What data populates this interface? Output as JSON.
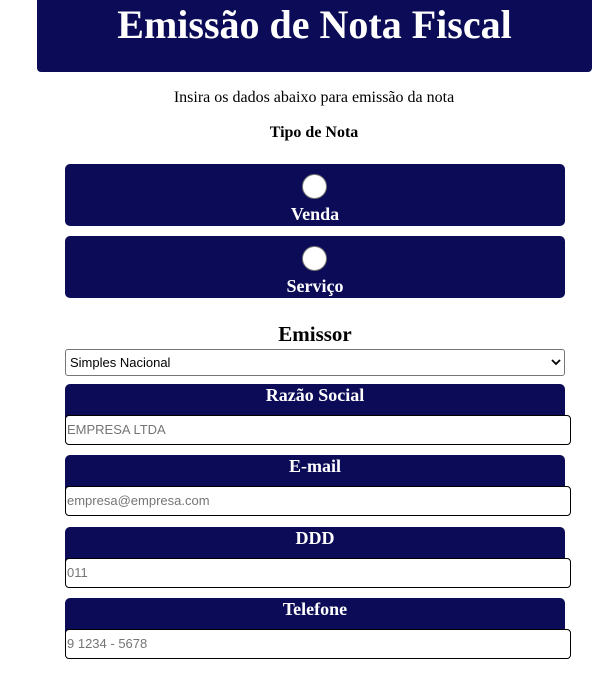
{
  "header": {
    "title": "Emissão de Nota Fiscal"
  },
  "intro": {
    "subtitle": "Insira os dados abaixo para emissão da nota",
    "type_label": "Tipo de Nota"
  },
  "note_types": [
    {
      "label": "Venda",
      "selected": false
    },
    {
      "label": "Serviço",
      "selected": false
    }
  ],
  "emissor": {
    "title": "Emissor",
    "selected_option": "Simples Nacional"
  },
  "fields": [
    {
      "label": "Razão Social",
      "placeholder": "EMPRESA LTDA"
    },
    {
      "label": "E-mail",
      "placeholder": "empresa@empresa.com"
    },
    {
      "label": "DDD",
      "placeholder": "011"
    },
    {
      "label": "Telefone",
      "placeholder": "9 1234 - 5678"
    }
  ],
  "colors": {
    "primary": "#0b0b57",
    "text_on_primary": "#ffffff",
    "placeholder": "#757575"
  }
}
